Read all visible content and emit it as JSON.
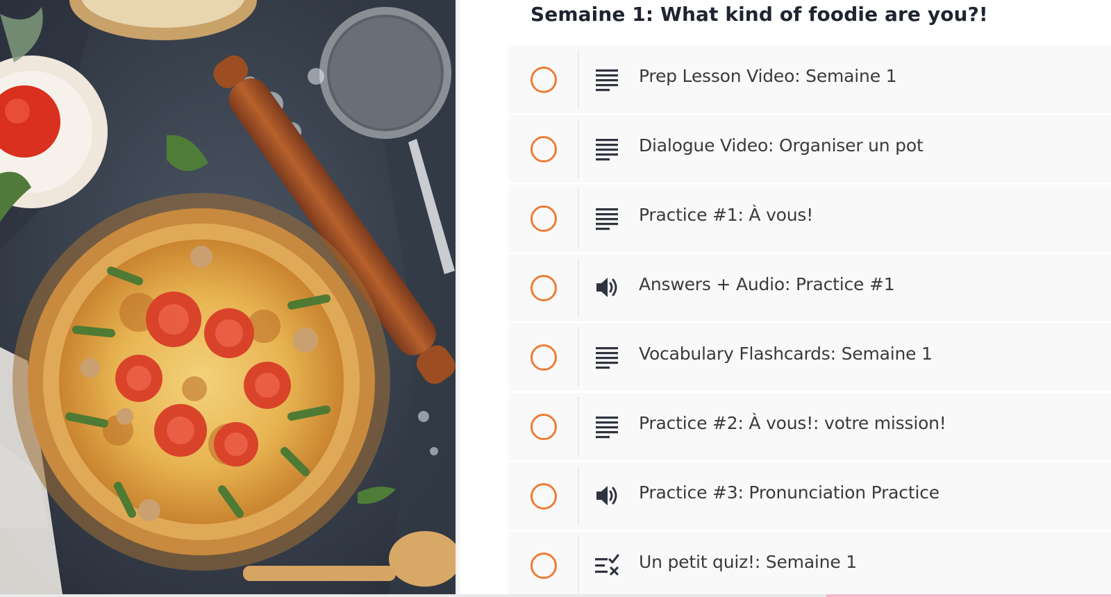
{
  "section": {
    "title": "Semaine 1: What kind of foodie are you?!"
  },
  "hero_image": {
    "subject": "quiche-on-table-photo"
  },
  "colors": {
    "status_ring": "#f07a33",
    "row_background": "#f9f9f9",
    "title_text": "#1f2430",
    "item_text": "#3a3a3a",
    "icon": "#2f3440"
  },
  "lessons": [
    {
      "title": "Prep Lesson Video: Semaine 1",
      "icon": "text-lines-icon",
      "completed": false
    },
    {
      "title": "Dialogue Video: Organiser un pot",
      "icon": "text-lines-icon",
      "completed": false
    },
    {
      "title": "Practice #1: À vous!",
      "icon": "text-lines-icon",
      "completed": false
    },
    {
      "title": "Answers + Audio: Practice #1",
      "icon": "speaker-icon",
      "completed": false
    },
    {
      "title": "Vocabulary Flashcards: Semaine 1",
      "icon": "text-lines-icon",
      "completed": false
    },
    {
      "title": "Practice #2: À vous!: votre mission!",
      "icon": "text-lines-icon",
      "completed": false
    },
    {
      "title": "Practice #3: Pronunciation Practice",
      "icon": "speaker-icon",
      "completed": false
    },
    {
      "title": "Un petit quiz!: Semaine 1",
      "icon": "quiz-checklist-icon",
      "completed": false
    }
  ]
}
